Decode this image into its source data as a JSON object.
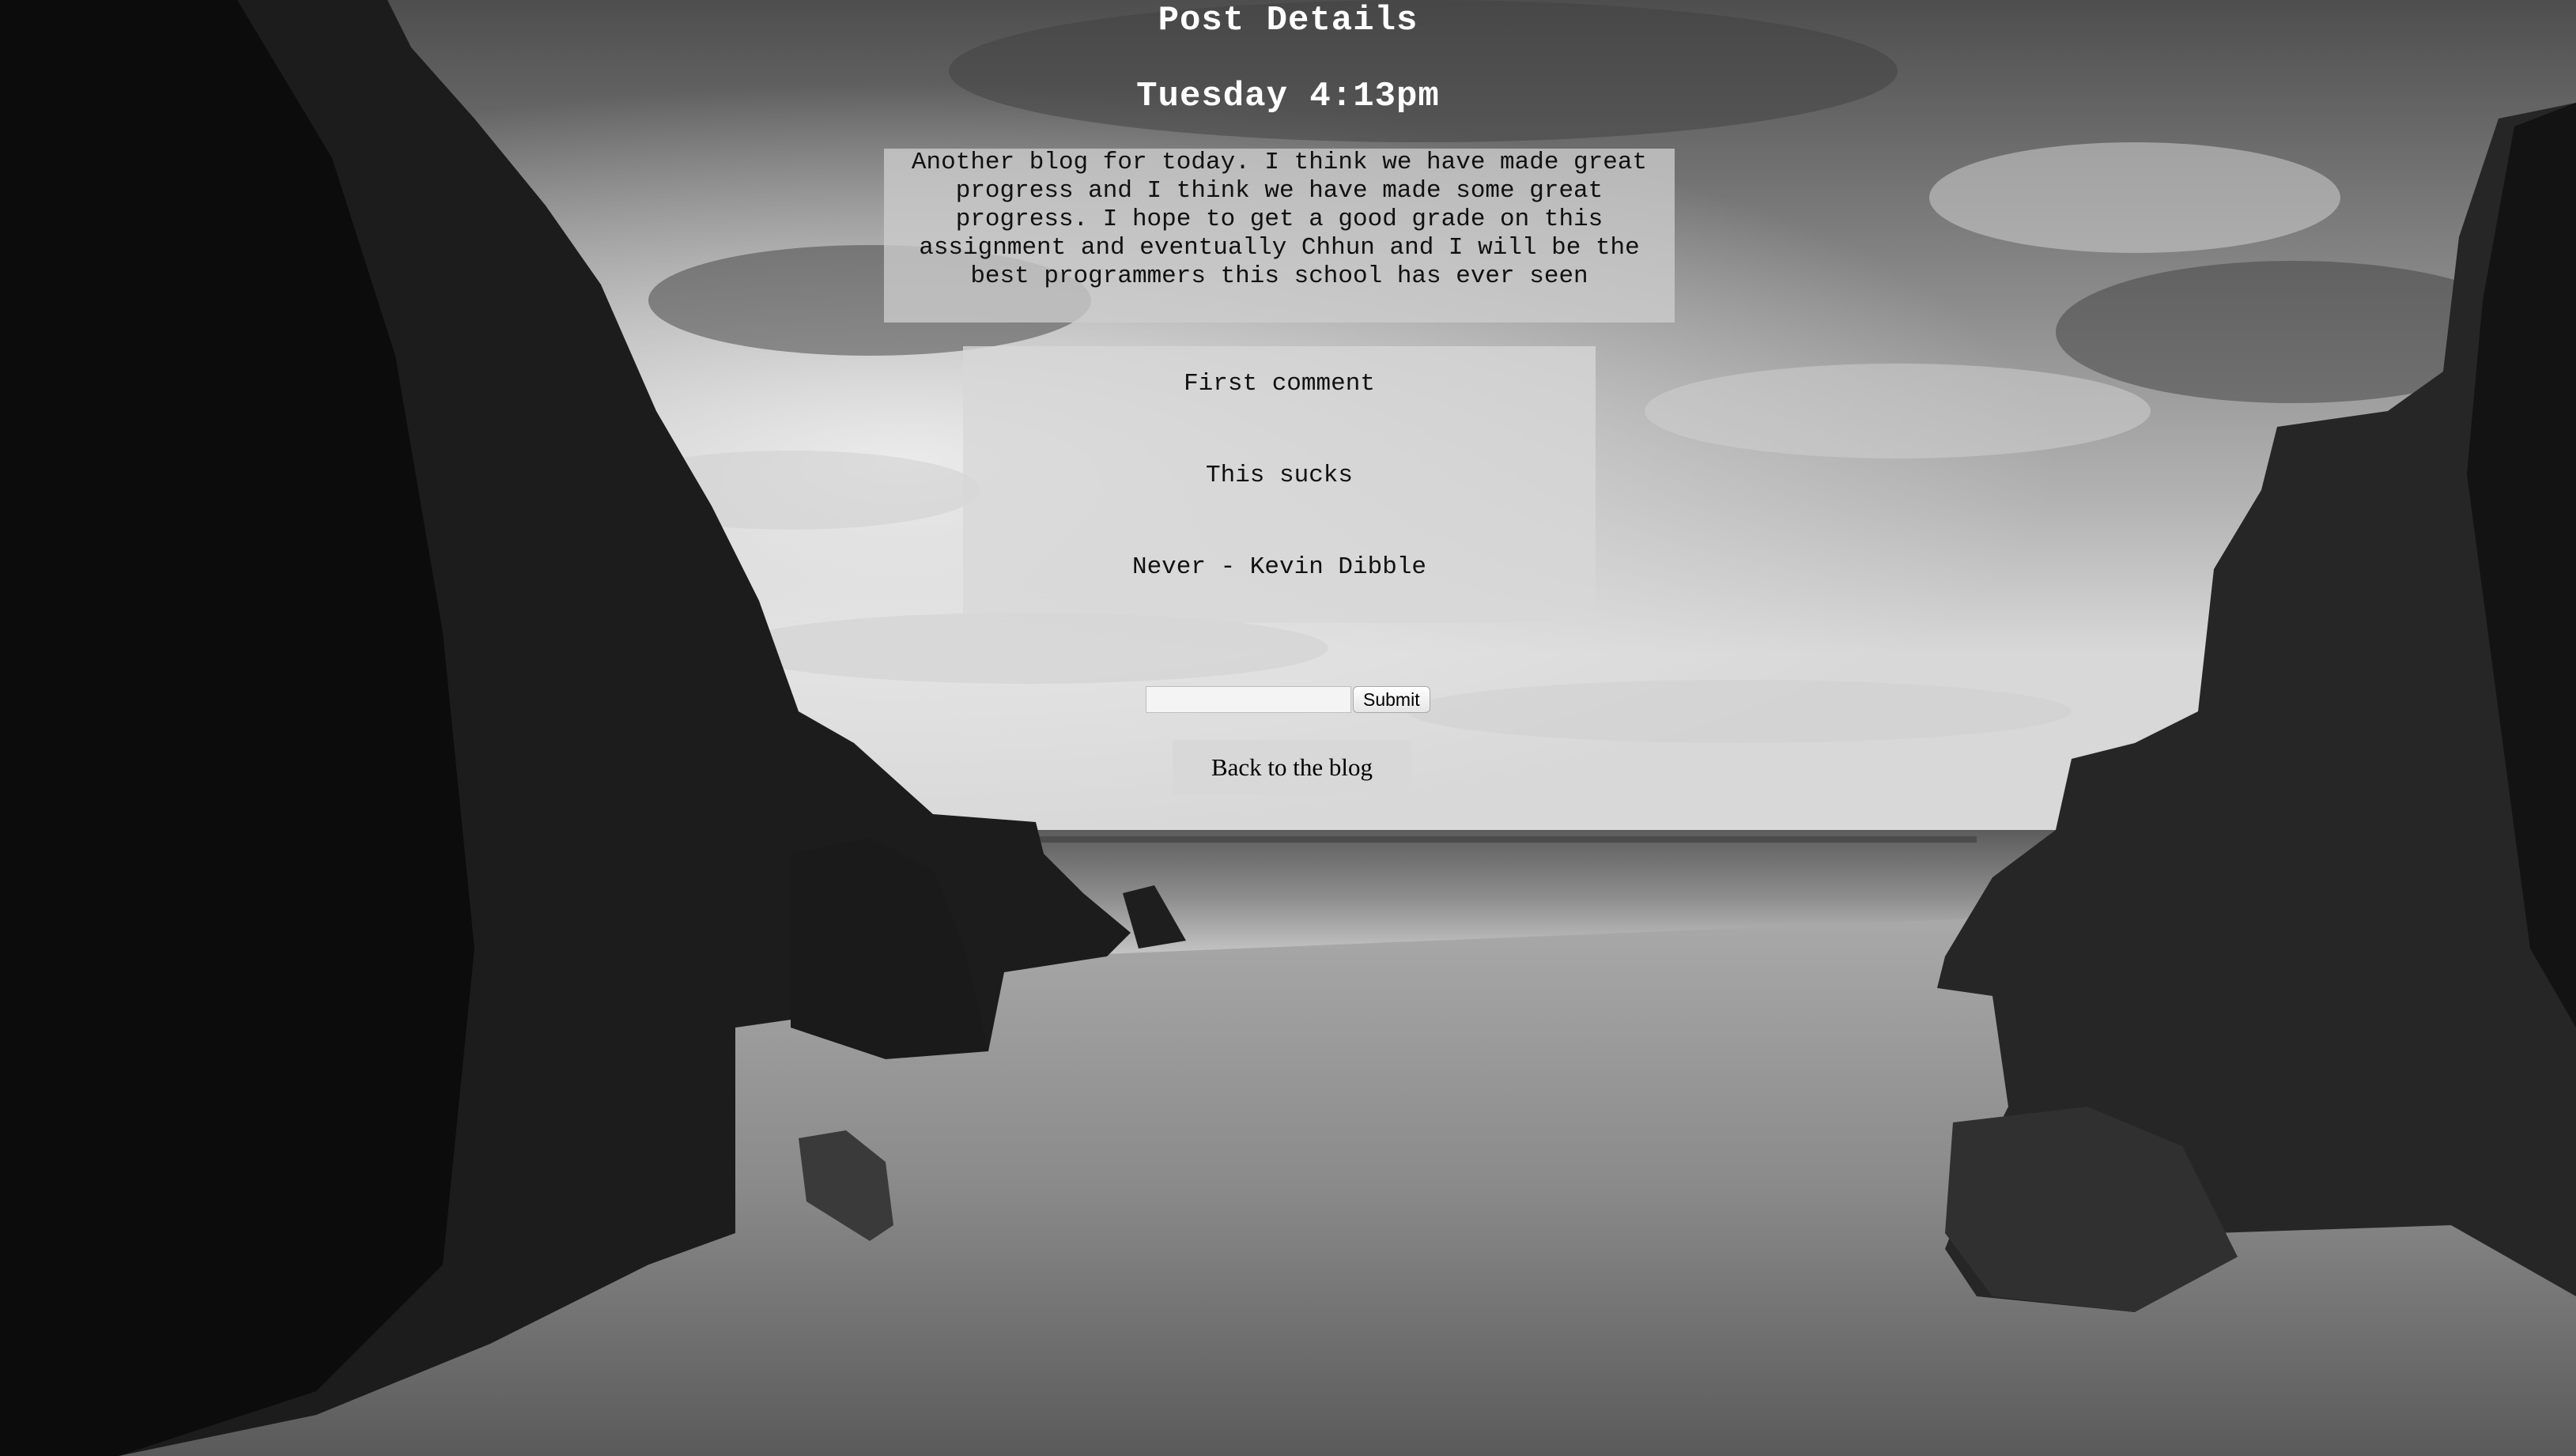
{
  "page": {
    "title": "Post Details",
    "time": "Tuesday 4:13pm"
  },
  "post": {
    "body": "Another blog for today. I think we have made great progress and I think we have made some great progress. I hope to get a good grade on this assignment and eventually Chhun and I will be the best programmers this school has ever seen"
  },
  "comments": [
    {
      "text": "First comment"
    },
    {
      "text": "This sucks"
    },
    {
      "text": "Never - Kevin Dibble"
    }
  ],
  "comment_form": {
    "input_value": "",
    "submit_label": "Submit"
  },
  "back_link": {
    "label": "Back to the blog"
  },
  "background": {
    "scene": "black-and-white beach between rock cliffs under cloudy sky"
  }
}
